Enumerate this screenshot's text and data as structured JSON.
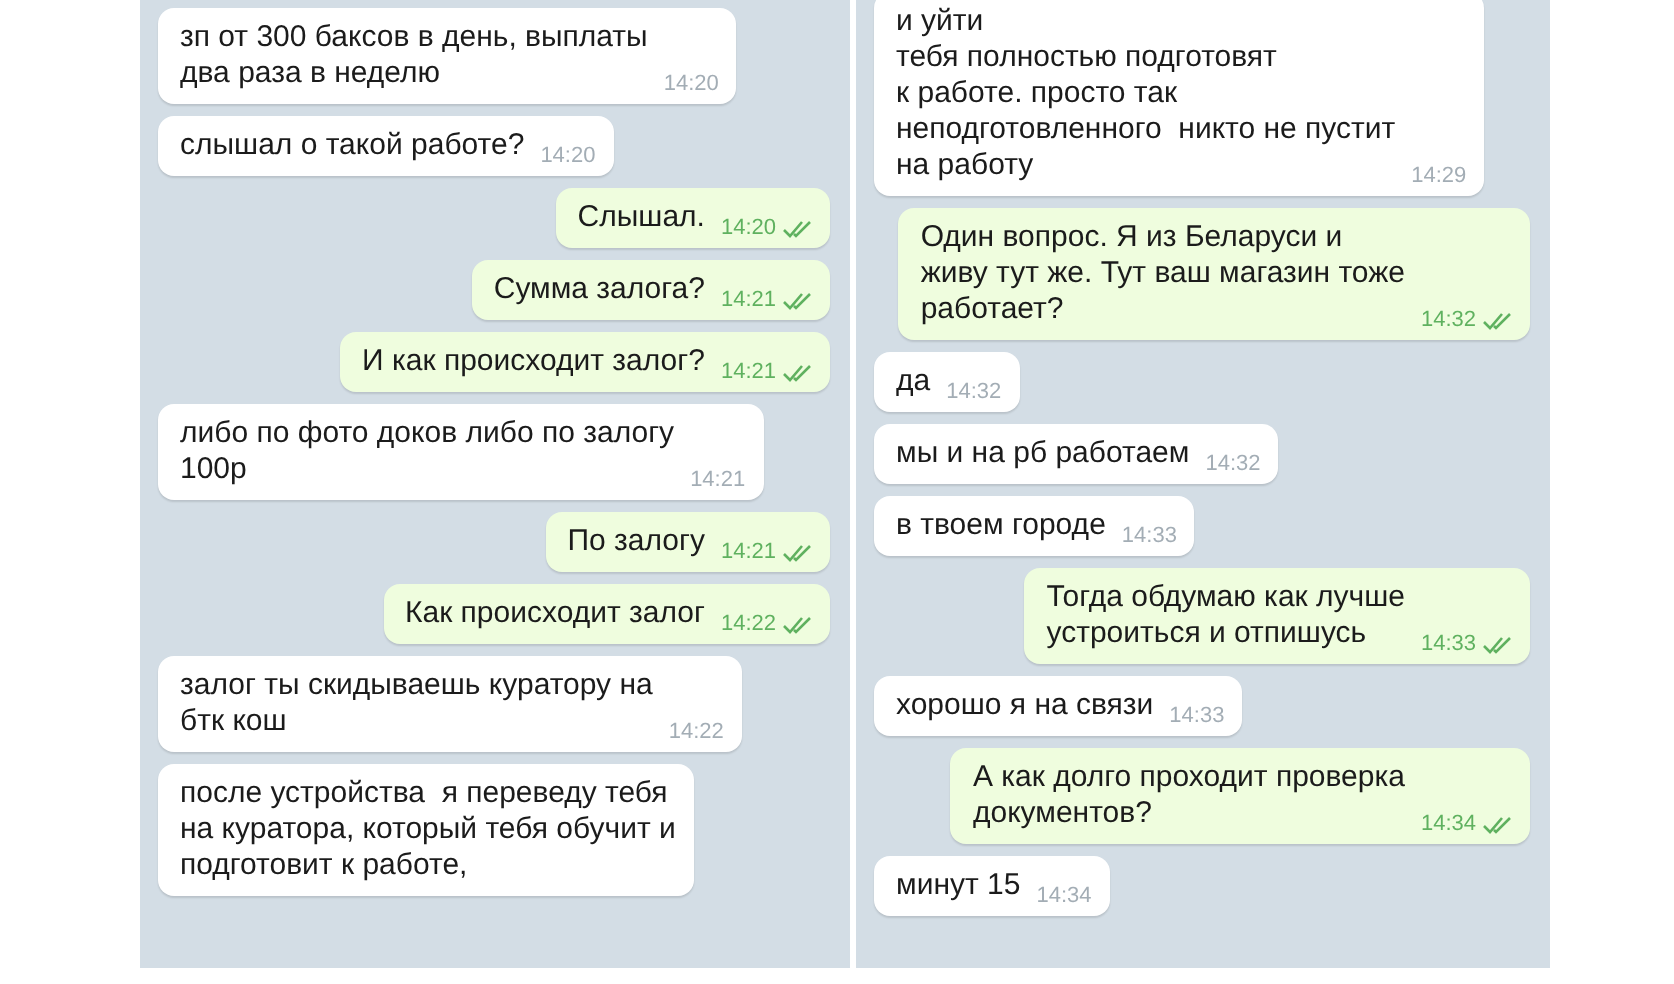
{
  "panels": [
    {
      "messages": [
        {
          "kind": "incoming",
          "text": "зп от 300 баксов в день, выплаты\nдва раза в неделю",
          "time": "14:20"
        },
        {
          "kind": "incoming",
          "text": "слышал о такой работе?",
          "time": "14:20"
        },
        {
          "kind": "outgoing",
          "text": "Слышал.",
          "time": "14:20"
        },
        {
          "kind": "outgoing",
          "text": "Сумма залога?",
          "time": "14:21"
        },
        {
          "kind": "outgoing",
          "text": "И как происходит залог?",
          "time": "14:21"
        },
        {
          "kind": "incoming",
          "text": "либо по фото доков либо по залогу\n100р",
          "time": "14:21"
        },
        {
          "kind": "outgoing",
          "text": "По залогу",
          "time": "14:21"
        },
        {
          "kind": "outgoing",
          "text": "Как происходит залог",
          "time": "14:22"
        },
        {
          "kind": "incoming",
          "text": "залог ты скидываешь куратору на\nбтк кош",
          "time": "14:22"
        },
        {
          "kind": "incoming",
          "text": "после устройства  я переведу тебя\nна куратора, который тебя обучит и\nподготовит к работе,"
        }
      ]
    },
    {
      "messages": [
        {
          "kind": "incoming",
          "text": "и уйти\nтебя полностью подготовят\nк работе. просто так\nнеподготовленного  никто не пустит\nна работу",
          "time": "14:29"
        },
        {
          "kind": "outgoing",
          "text": "Один вопрос. Я из Беларуси и\nживу тут же. Тут ваш магазин тоже\nработает?",
          "time": "14:32"
        },
        {
          "kind": "incoming",
          "text": "да",
          "time": "14:32"
        },
        {
          "kind": "incoming",
          "text": "мы и на рб работаем",
          "time": "14:32"
        },
        {
          "kind": "incoming",
          "text": "в твоем городе",
          "time": "14:33"
        },
        {
          "kind": "outgoing",
          "text": "Тогда обдумаю как лучше\nустроиться и отпишусь",
          "time": "14:33"
        },
        {
          "kind": "incoming",
          "text": "хорошо я на связи",
          "time": "14:33"
        },
        {
          "kind": "outgoing",
          "text": "А как долго проходит проверка\nдокументов?",
          "time": "14:34"
        },
        {
          "kind": "incoming",
          "text": "минут 15",
          "time": "14:34"
        }
      ]
    }
  ]
}
